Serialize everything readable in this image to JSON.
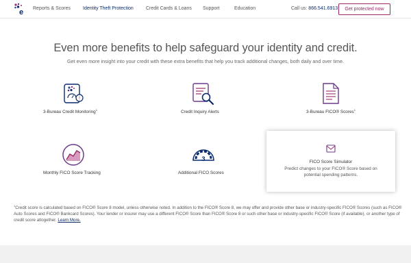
{
  "header": {
    "nav": [
      "Reports & Scores",
      "Identity Theft Protection",
      "Credit Cards & Loans",
      "Support",
      "Education"
    ],
    "active_index": 1,
    "call_label": "Call us:",
    "call_number": "866.541.6913",
    "cta_label": "Get protected now"
  },
  "main": {
    "title": "Even more benefits to help safeguard your identity and credit.",
    "subtitle": "Get even more insight into your credit with these extra benefits that help you track additional changes, both daily and over time."
  },
  "benefits": [
    {
      "label": "3-Bureau Credit Monitoring",
      "sup": "1",
      "icon": "monitoring-icon"
    },
    {
      "label": "Credit Inquiry Alerts",
      "sup": "",
      "icon": "inquiry-icon"
    },
    {
      "label": "3-Bureau FICO® Scores",
      "sup": "1",
      "icon": "document-icon"
    },
    {
      "label": "Monthly FICO Score Tracking",
      "sup": "",
      "icon": "tracking-icon"
    },
    {
      "label": "Additional FICO Scores",
      "sup": "",
      "icon": "gauge-icon"
    }
  ],
  "card": {
    "title": "FICO Score Simulator",
    "description": "Predict changes to your FICO® Score based on potential spending patterns.",
    "icon": "envelope-icon"
  },
  "disclaimer": {
    "sup": "1",
    "text": "Credit score is calculated based on FICO® Score 8 model, unless otherwise noted. In addition to the FICO® Score 8, we may offer and provide other base or industry-specific FICO® Scores (such as FICO® Auto Scores and FICO® Bankcard Scores). Your lender or insurer may use a different FICO® Score than FICO® Score 8 or such other base or industry-specific FICO® Score (if available), or another type of credit score altogether.",
    "link": "Learn More."
  },
  "colors": {
    "brand_navy": "#0a2a6c",
    "brand_magenta": "#9c2a68",
    "icon_purple": "#6b3a8a"
  }
}
